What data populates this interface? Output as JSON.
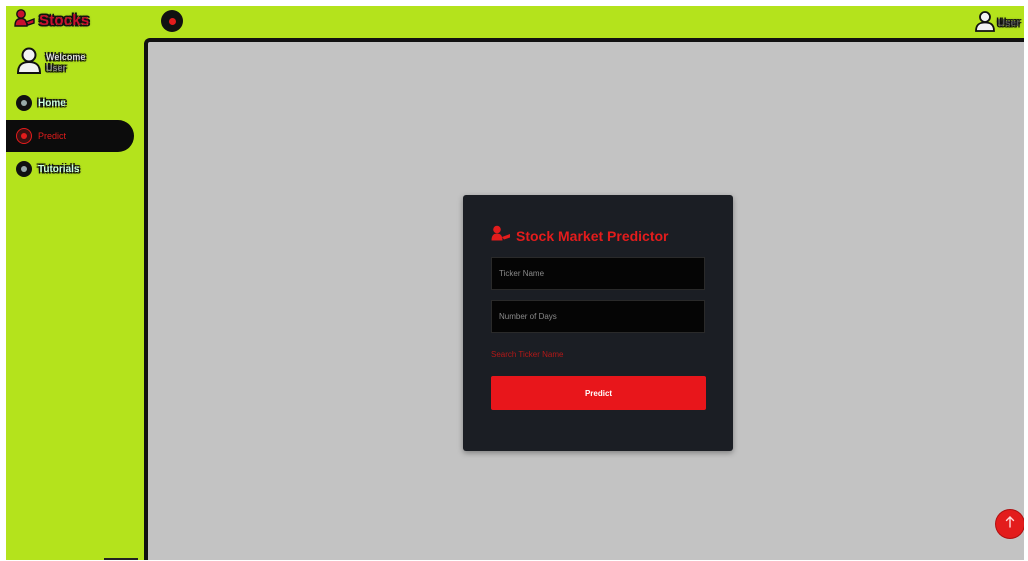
{
  "brand": {
    "name": "Stocks",
    "icon": "user-tie-icon"
  },
  "topbar": {
    "menu_icon": "menu-toggle-icon",
    "user_name": "User",
    "user_icon": "avatar-icon"
  },
  "sidebar": {
    "welcome_label": "Welcome",
    "user_name": "User",
    "items": [
      {
        "label": "Home",
        "icon": "home-icon",
        "active": false
      },
      {
        "label": "Predict",
        "icon": "search-icon",
        "active": true
      },
      {
        "label": "Tutorials",
        "icon": "tutorials-icon",
        "active": false
      }
    ]
  },
  "form": {
    "title": "Stock Market Predictor",
    "title_icon": "user-tie-icon",
    "ticker_placeholder": "Ticker Name",
    "days_placeholder": "Number of Days",
    "search_link": "Search Ticker Name",
    "submit_label": "Predict"
  },
  "scroll_top": {
    "icon": "arrow-up-icon"
  },
  "colors": {
    "accent": "#e31c1c",
    "sidebar_bg": "#b4e31c",
    "content_bg": "#c3c3c3",
    "card_bg": "#1b1e24"
  }
}
